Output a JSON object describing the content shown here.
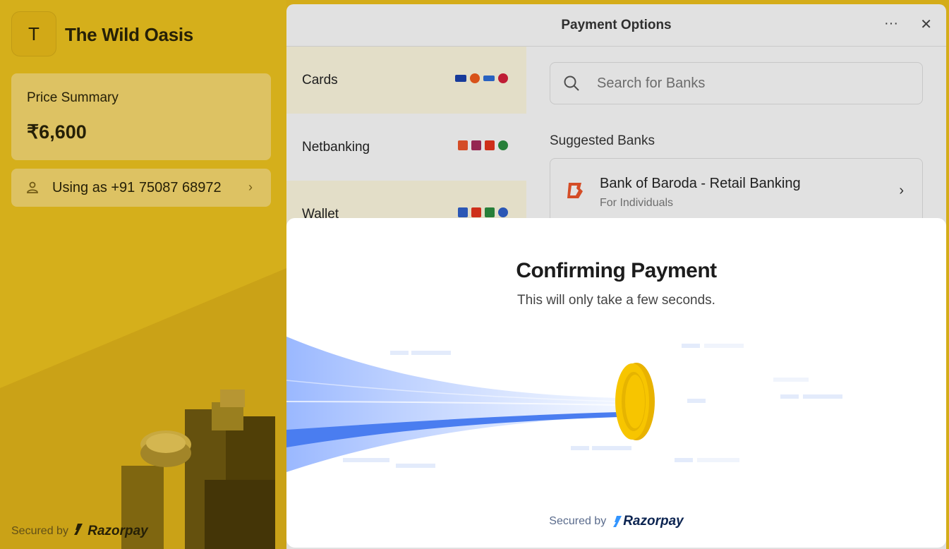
{
  "merchant": {
    "initial": "T",
    "name": "The Wild Oasis"
  },
  "price_summary": {
    "label": "Price Summary",
    "amount": "₹6,600"
  },
  "user": {
    "label": "Using as +91 75087 68972"
  },
  "left_footer": {
    "secured_by": "Secured by",
    "brand": "Razorpay"
  },
  "payment_options": {
    "title": "Payment Options",
    "more_icon": "ellipsis-icon",
    "close_icon": "close-icon",
    "methods": [
      {
        "label": "Cards",
        "icons": [
          "visa-logo",
          "mastercard-logo",
          "rupay-logo",
          "maestro-logo"
        ]
      },
      {
        "label": "Netbanking",
        "icons": [
          "bob-logo",
          "axis-logo",
          "kotak-logo",
          "icici-logo"
        ]
      },
      {
        "label": "Wallet",
        "icons": [
          "phonepe-logo",
          "airtel-logo",
          "mobikwik-logo",
          "wallet-logo"
        ]
      }
    ],
    "search": {
      "placeholder": "Search for Banks"
    },
    "suggested_title": "Suggested Banks",
    "suggested_banks": [
      {
        "name": "Bank of Baroda - Retail Banking",
        "subtitle": "For Individuals"
      }
    ]
  },
  "confirm": {
    "title": "Confirming Payment",
    "subtitle": "This will only take a few seconds.",
    "secured_by": "Secured by",
    "brand": "Razorpay"
  },
  "colors": {
    "brand_yellow": "#e8be1e",
    "card_yellow": "#f0d36c",
    "coin_gold": "#f7c500",
    "stream_blue": "#4a7df0",
    "razorpay_navy": "#0c2451",
    "razorpay_blue": "#3395ff"
  }
}
